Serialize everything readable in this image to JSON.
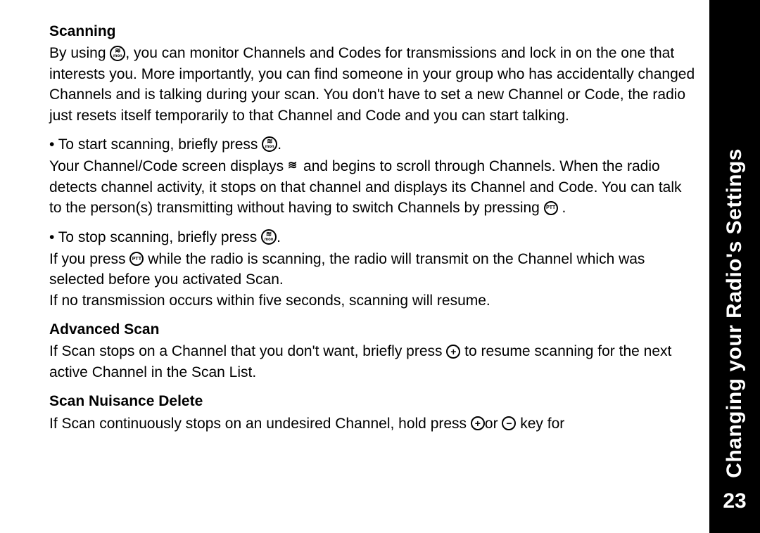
{
  "sidebar": {
    "title": "Changing your Radio's Settings",
    "page_number": "23"
  },
  "sections": {
    "scanning": {
      "heading": "Scanning",
      "intro_p1": "By using ",
      "intro_p2": ", you can monitor Channels and Codes for transmissions and lock in on the one that interests you. More importantly, you can find someone in your group who has accidentally changed Channels and is talking during your scan. You don't have to set a new Channel or Code, the radio just resets itself temporarily to that Channel and Code and you can start talking.",
      "bullet1_p1": "• To start scanning, briefly press ",
      "bullet1_p2": ".",
      "detail1_p1": "Your Channel/Code screen displays ",
      "detail1_p2": " and begins to scroll through Channels. When the radio detects channel activity, it stops on that channel and displays its Channel and Code. You can talk to the person(s) transmitting without having to switch Channels by pressing ",
      "detail1_p3": " .",
      "bullet2_p1": "• To stop scanning, briefly press ",
      "bullet2_p2": ".",
      "detail2_p1": "If you press ",
      "detail2_p2": " while the radio is scanning, the radio will transmit on the Channel which was selected before you activated Scan.",
      "detail3": "If no transmission occurs within five seconds, scanning will resume."
    },
    "advanced": {
      "heading": "Advanced Scan",
      "p1": "If Scan stops on a Channel that you don't want, briefly press ",
      "p2": " to resume scanning for the next active Channel in the Scan List."
    },
    "nuisance": {
      "heading": "Scan Nuisance Delete",
      "p1": "If Scan continuously stops on an undesired Channel, hold press ",
      "p2": "or ",
      "p3": " key for"
    }
  },
  "icons": {
    "scan_top": "⌇",
    "scan_bottom": "mon",
    "ptt": "PTT",
    "plus": "+",
    "minus": "−",
    "zigzag": "⌇⌇"
  }
}
